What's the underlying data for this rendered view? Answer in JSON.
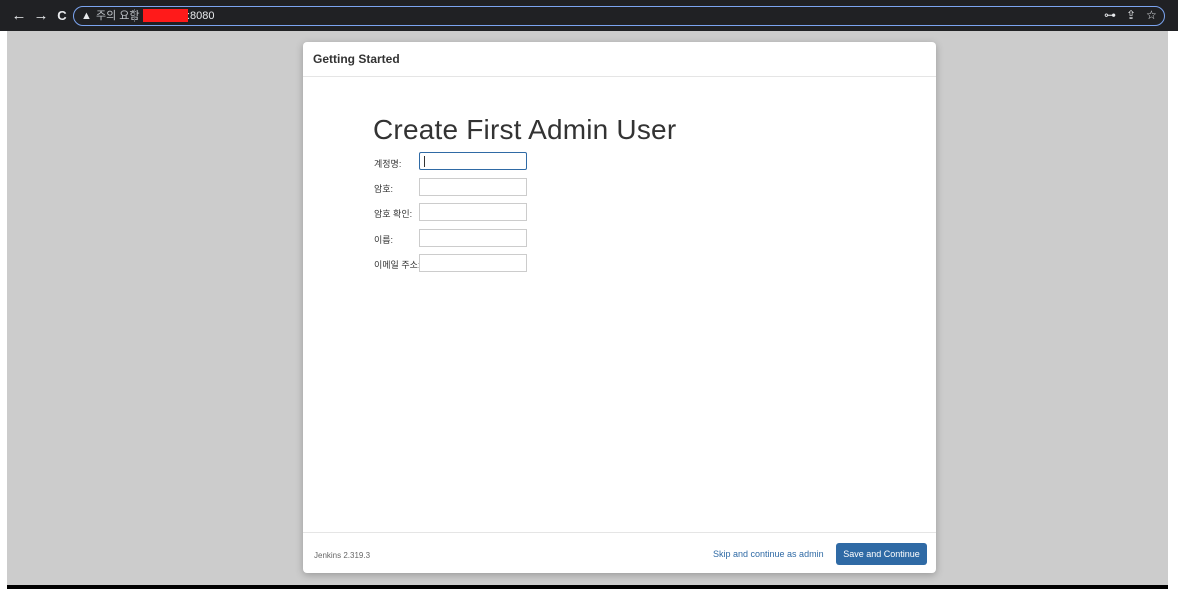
{
  "browser": {
    "back_icon": "←",
    "forward_icon": "→",
    "reload_icon": "C",
    "warning_icon": "▲",
    "warning_text": "주의 요함",
    "url_port": ":8080",
    "key_icon": "⊶",
    "share_icon": "⇪",
    "star_icon": "☆"
  },
  "dialog": {
    "header_title": "Getting Started",
    "heading": "Create First Admin User",
    "fields": [
      {
        "label": "계정명:",
        "value": "",
        "focused": true
      },
      {
        "label": "암호:",
        "value": ""
      },
      {
        "label": "암호 확인:",
        "value": ""
      },
      {
        "label": "이름:",
        "value": ""
      },
      {
        "label": "이메일 주소:",
        "value": ""
      }
    ],
    "footer": {
      "version": "Jenkins 2.319.3",
      "skip_label": "Skip and continue as admin",
      "save_label": "Save and Continue"
    }
  }
}
